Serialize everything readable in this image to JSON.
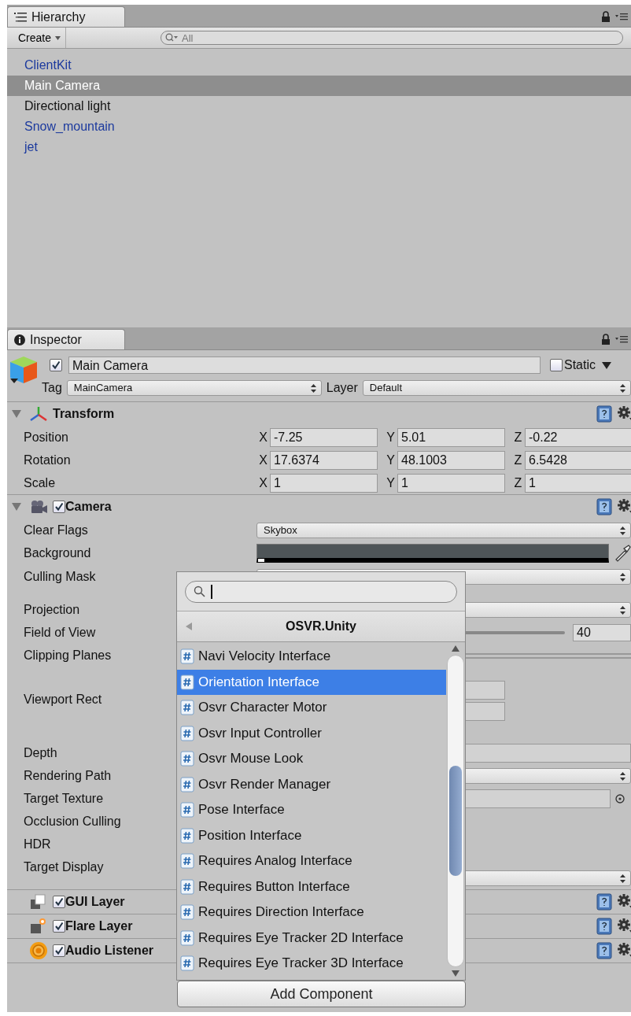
{
  "hierarchy": {
    "tab": {
      "title": "Hierarchy"
    },
    "create_button": "Create",
    "search": {
      "placeholder": "All"
    },
    "items": [
      {
        "label": "ClientKit",
        "kind": "prefab",
        "selected": false
      },
      {
        "label": "Main Camera",
        "kind": "object",
        "selected": true
      },
      {
        "label": "Directional light",
        "kind": "object",
        "selected": false
      },
      {
        "label": "Snow_mountain",
        "kind": "prefab",
        "selected": false
      },
      {
        "label": "jet",
        "kind": "prefab",
        "selected": false
      }
    ]
  },
  "inspector": {
    "tab": {
      "title": "Inspector"
    },
    "object": {
      "active": true,
      "name": "Main Camera",
      "static": false,
      "static_label": "Static",
      "tag_label": "Tag",
      "tag": "MainCamera",
      "layer_label": "Layer",
      "layer": "Default"
    },
    "components": [
      {
        "name": "Transform",
        "kind": "transform",
        "expanded": true,
        "vectors": [
          {
            "label": "Position",
            "fields": [
              {
                "axis": "X",
                "value": "-7.25"
              },
              {
                "axis": "Y",
                "value": "5.01"
              },
              {
                "axis": "Z",
                "value": "-0.22"
              }
            ]
          },
          {
            "label": "Rotation",
            "fields": [
              {
                "axis": "X",
                "value": "17.6374"
              },
              {
                "axis": "Y",
                "value": "48.1003"
              },
              {
                "axis": "Z",
                "value": "6.5428"
              }
            ]
          },
          {
            "label": "Scale",
            "fields": [
              {
                "axis": "X",
                "value": "1"
              },
              {
                "axis": "Y",
                "value": "1"
              },
              {
                "axis": "Z",
                "value": "1"
              }
            ]
          }
        ]
      },
      {
        "name": "Camera",
        "kind": "camera",
        "enabled": true,
        "expanded": true,
        "properties": [
          {
            "label": "Clear Flags",
            "kind": "select",
            "value": "Skybox"
          },
          {
            "label": "Background",
            "kind": "color",
            "color": "#4f5558"
          },
          {
            "label": "Culling Mask",
            "kind": "mask"
          },
          {
            "label": "Projection",
            "kind": "select"
          },
          {
            "label": "Field of View",
            "kind": "slider",
            "value": "40"
          },
          {
            "label": "Clipping Planes",
            "kind": "clip"
          },
          {
            "label": "Viewport Rect",
            "kind": "rect"
          },
          {
            "label": "Depth",
            "kind": "field"
          },
          {
            "label": "Rendering Path",
            "kind": "select"
          },
          {
            "label": "Target Texture",
            "kind": "object"
          },
          {
            "label": "Occlusion Culling",
            "kind": "toggle"
          },
          {
            "label": "HDR",
            "kind": "toggle"
          },
          {
            "label": "Target Display",
            "kind": "display"
          }
        ]
      },
      {
        "name": "GUI Layer",
        "kind": "guilayer",
        "enabled": true,
        "expanded": false
      },
      {
        "name": "Flare Layer",
        "kind": "flare",
        "enabled": true,
        "expanded": false
      },
      {
        "name": "Audio Listener",
        "kind": "audio",
        "enabled": true,
        "expanded": false
      }
    ]
  },
  "add_component": {
    "category": "OSVR.Unity",
    "items": [
      {
        "label": "Navi Velocity Interface",
        "selected": false
      },
      {
        "label": "Orientation Interface",
        "selected": true
      },
      {
        "label": "Osvr Character Motor",
        "selected": false
      },
      {
        "label": "Osvr Input Controller",
        "selected": false
      },
      {
        "label": "Osvr Mouse Look",
        "selected": false
      },
      {
        "label": "Osvr Render Manager",
        "selected": false
      },
      {
        "label": "Pose Interface",
        "selected": false
      },
      {
        "label": "Position Interface",
        "selected": false
      },
      {
        "label": "Requires Analog Interface",
        "selected": false
      },
      {
        "label": "Requires Button Interface",
        "selected": false
      },
      {
        "label": "Requires Direction Interface",
        "selected": false
      },
      {
        "label": "Requires Eye Tracker 2D Interface",
        "selected": false
      },
      {
        "label": "Requires Eye Tracker 3D Interface",
        "selected": false
      }
    ],
    "button": "Add Component"
  }
}
